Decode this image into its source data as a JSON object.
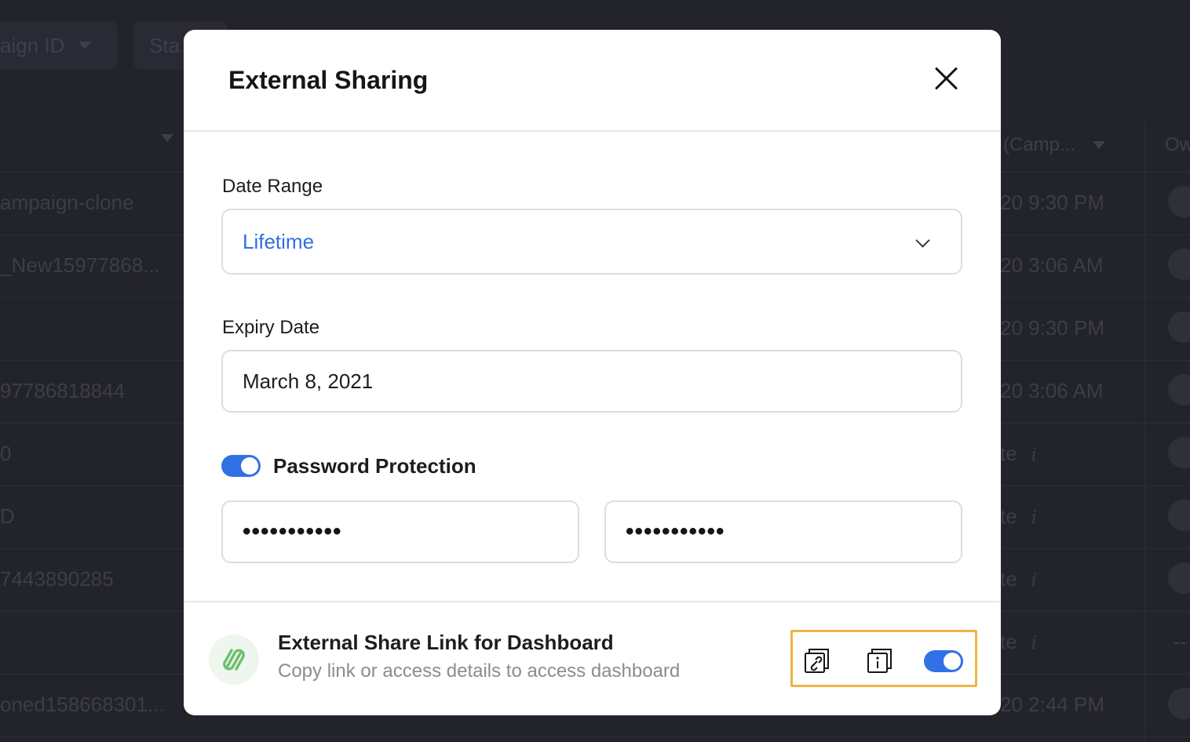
{
  "background": {
    "filters": [
      {
        "label": "aign ID"
      },
      {
        "label": "Sta"
      }
    ],
    "headers": {
      "mid_col": "(Camp...",
      "last_col": "Ow"
    },
    "rows": [
      {
        "left": "ampaign-clone",
        "right": "20 9:30 PM"
      },
      {
        "left": "_New15977868...",
        "right": "20 3:06 AM"
      },
      {
        "left": "",
        "right": "20 9:30 PM"
      },
      {
        "left": "97786818844",
        "right": "20 3:06 AM"
      },
      {
        "left": "0",
        "right": "te"
      },
      {
        "left": "D",
        "right": "te"
      },
      {
        "left": "7443890285",
        "right": "te"
      },
      {
        "left": "",
        "right": "te"
      },
      {
        "left": "oned158668301...",
        "right": "20 2:44 PM"
      }
    ],
    "info_glyph": "i",
    "dash": "--"
  },
  "modal": {
    "title": "External Sharing",
    "date_range": {
      "label": "Date Range",
      "value": "Lifetime"
    },
    "expiry_date": {
      "label": "Expiry Date",
      "value": "March 8, 2021"
    },
    "password_protection": {
      "label": "Password Protection",
      "enabled": true,
      "password": "•••••••••••",
      "confirm_password": "•••••••••••"
    },
    "share_link": {
      "title": "External Share Link for Dashboard",
      "subtitle": "Copy link or access details to access dashboard",
      "enabled": true
    }
  },
  "colors": {
    "accent": "#3071e6",
    "highlight_border": "#f0b442",
    "link_icon": "#6cc06c"
  },
  "icons": [
    "close-icon",
    "chevron-down-icon",
    "link-icon",
    "copy-link-icon",
    "copy-info-icon"
  ]
}
